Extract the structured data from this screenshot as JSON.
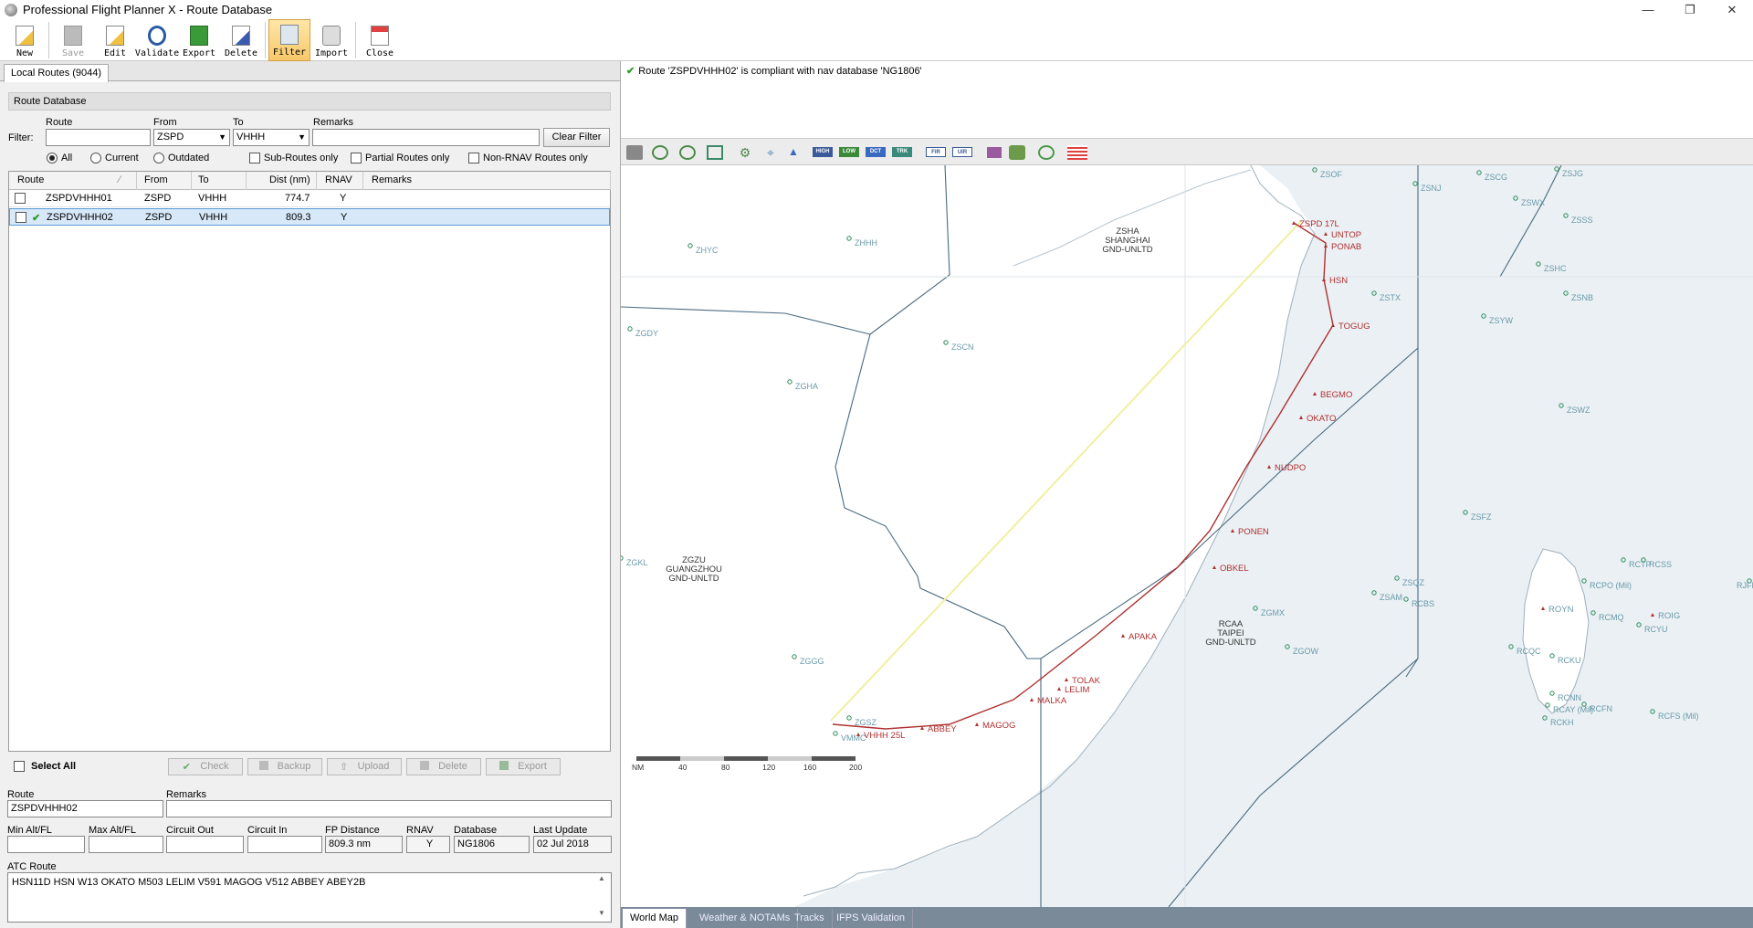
{
  "window": {
    "title": "Professional Flight Planner X - Route Database",
    "minimize": "—",
    "restore": "❐",
    "close": "✕"
  },
  "toolbar": {
    "new": "New",
    "save": "Save",
    "edit": "Edit",
    "validate": "Validate",
    "export": "Export",
    "delete": "Delete",
    "filter": "Filter",
    "import": "Import",
    "close": "Close"
  },
  "left": {
    "tab": "Local Routes (9044)",
    "header": "Route Database",
    "filter": {
      "label": "Filter:",
      "route_label": "Route",
      "from_label": "From",
      "to_label": "To",
      "remarks_label": "Remarks",
      "route_value": "",
      "from_value": "ZSPD",
      "to_value": "VHHH",
      "remarks_value": "",
      "clear": "Clear Filter",
      "opt_all": "All",
      "opt_current": "Current",
      "opt_outdated": "Outdated",
      "opt_sub": "Sub-Routes only",
      "opt_partial": "Partial Routes only",
      "opt_nonrnav": "Non-RNAV Routes only"
    },
    "columns": [
      "Route",
      "From",
      "To",
      "Dist (nm)",
      "RNAV",
      "Remarks"
    ],
    "rows": [
      {
        "route": "ZSPDVHHH01",
        "from": "ZSPD",
        "to": "VHHH",
        "dist": "774.7",
        "rnav": "Y",
        "remarks": "",
        "valid": false
      },
      {
        "route": "ZSPDVHHH02",
        "from": "ZSPD",
        "to": "VHHH",
        "dist": "809.3",
        "rnav": "Y",
        "remarks": "",
        "valid": true
      }
    ],
    "select_all": "Select All",
    "actions": [
      "Check",
      "Backup",
      "Upload",
      "Delete",
      "Export"
    ],
    "details": {
      "route_label": "Route",
      "route_value": "ZSPDVHHH02",
      "remarks_label": "Remarks",
      "remarks_value": "",
      "min_alt_label": "Min Alt/FL",
      "max_alt_label": "Max Alt/FL",
      "circuit_out_label": "Circuit Out",
      "circuit_in_label": "Circuit In",
      "fp_dist_label": "FP Distance",
      "fp_dist_value": "809.3 nm",
      "rnav_label": "RNAV",
      "rnav_value": "Y",
      "database_label": "Database",
      "database_value": "NG1806",
      "last_update_label": "Last Update",
      "last_update_value": "02 Jul 2018",
      "atc_label": "ATC Route",
      "atc_value": "HSN11D HSN W13 OKATO M503 LELIM V591 MAGOG V512 ABBEY ABEY2B"
    }
  },
  "right": {
    "status": "Route 'ZSPDVHHH02' is compliant with nav database 'NG1806'",
    "map_toolbar": [
      "HIGH",
      "LOW",
      "DCT",
      "TRK",
      "FIR",
      "UIR"
    ],
    "map": {
      "airports": [
        "ZSJG",
        "ZSCG",
        "ZSNJ",
        "ZSWX",
        "ZSSS",
        "ZSOF",
        "ZHHH",
        "ZHYC",
        "ZSHC",
        "ZSTX",
        "ZSNB",
        "ZSYW",
        "ZGDY",
        "ZSCN",
        "ZGHA",
        "ZSWZ",
        "ZSFZ",
        "RCTP",
        "RCSS",
        "RCPO (Mil)",
        "RCMQ",
        "ZSQZ",
        "ZSAM",
        "RCBS",
        "ZGMX",
        "RCYU",
        "RCQC",
        "RCKU",
        "ZGOW",
        "ZGGG",
        "RCNN",
        "RCAY (Mil)",
        "RCFN",
        "RCKH",
        "ZGSZ",
        "VMMC",
        "RCFS (Mil)",
        "RJFMY",
        "ZGKL"
      ],
      "waypoints": [
        "ZSPD 17L",
        "UNTOP",
        "PONAB",
        "HSN",
        "TOGUG",
        "BEGMO",
        "OKATO",
        "NUDPO",
        "PONEN",
        "OBKEL",
        "APAKA",
        "TOLAK",
        "LELIM",
        "MALKA",
        "MAGOG",
        "ABBEY",
        "VHHH 25L",
        "ROYN",
        "ROIG"
      ],
      "firs": [
        {
          "id": "ZSHA",
          "name": "SHANGHAI",
          "limits": "GND-UNLTD"
        },
        {
          "id": "ZGZU",
          "name": "GUANGZHOU",
          "limits": "GND-UNLTD"
        },
        {
          "id": "RCAA",
          "name": "TAIPEI",
          "limits": "GND-UNLTD"
        }
      ],
      "scale": [
        "NM",
        "40",
        "80",
        "120",
        "160",
        "200"
      ]
    },
    "bottom_tabs": [
      "World Map",
      "Weather & NOTAMs",
      "Tracks",
      "IFPS Validation"
    ]
  }
}
